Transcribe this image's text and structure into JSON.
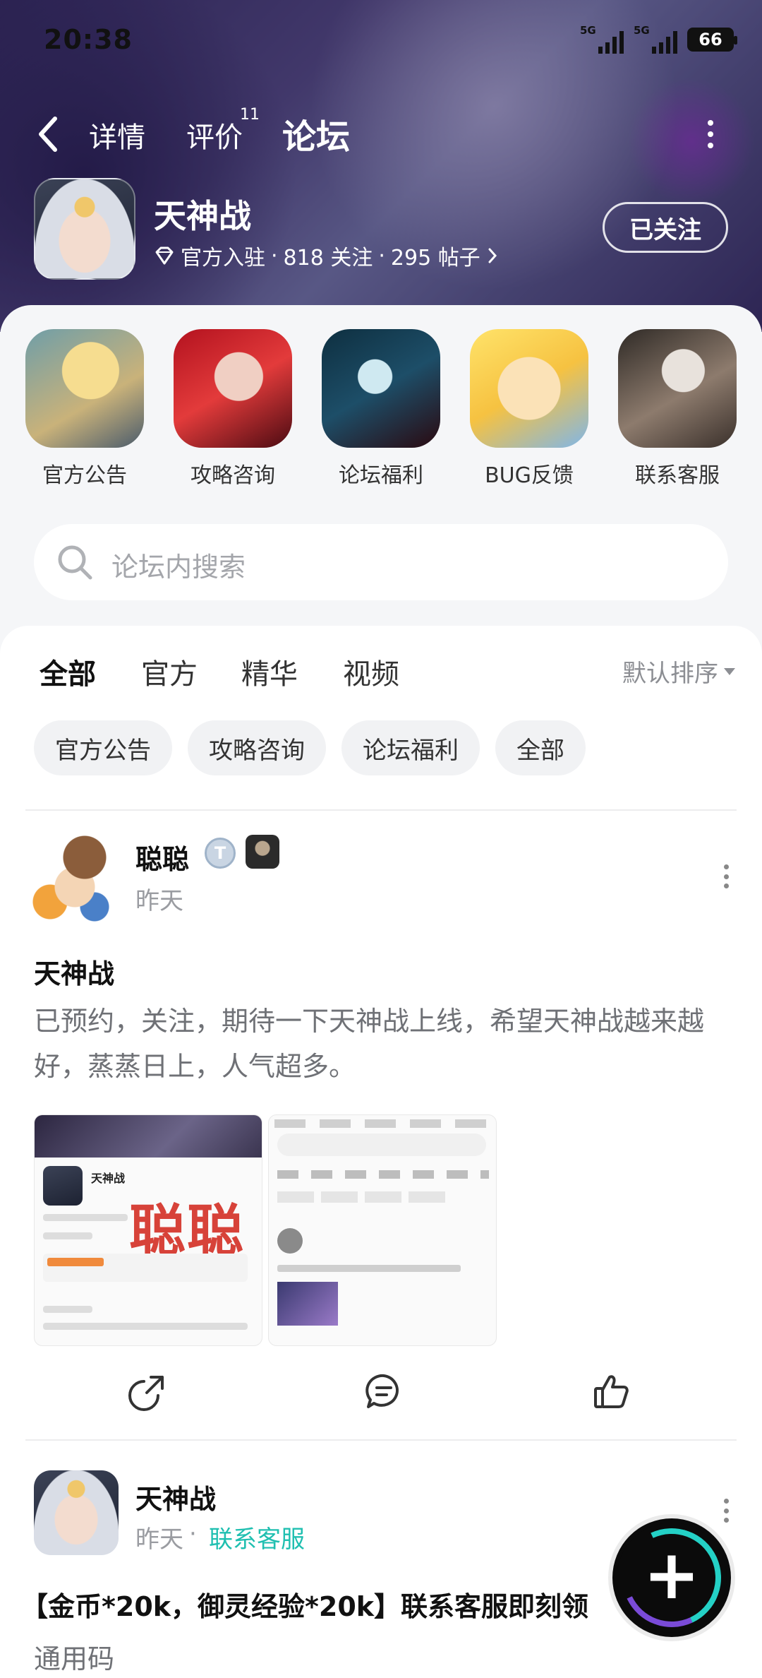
{
  "status_bar": {
    "time": "20:38",
    "network_1": "5G",
    "network_2": "5G",
    "battery": "66"
  },
  "nav": {
    "tabs": [
      {
        "label": "详情"
      },
      {
        "label": "评价"
      },
      {
        "label": "论坛"
      }
    ],
    "review_count": "11",
    "active_tab": "论坛"
  },
  "game": {
    "title": "天神战",
    "official_text": "官方入驻",
    "followers": "818 关注",
    "posts": "295 帖子",
    "separator": "·",
    "follow_button": "已关注"
  },
  "shortcuts": [
    {
      "label": "官方公告"
    },
    {
      "label": "攻略咨询"
    },
    {
      "label": "论坛福利"
    },
    {
      "label": "BUG反馈"
    },
    {
      "label": "联系客服"
    }
  ],
  "search": {
    "placeholder": "论坛内搜索"
  },
  "filters": {
    "tabs": [
      {
        "label": "全部"
      },
      {
        "label": "官方"
      },
      {
        "label": "精华"
      },
      {
        "label": "视频"
      }
    ],
    "sort_label": "默认排序",
    "chips": [
      {
        "label": "官方公告"
      },
      {
        "label": "攻略咨询"
      },
      {
        "label": "论坛福利"
      },
      {
        "label": "全部"
      }
    ]
  },
  "posts": [
    {
      "author": "聪聪",
      "time": "昨天",
      "title": "天神战",
      "body": "已预约，关注，期待一下天神战上线，希望天神战越来越好，蒸蒸日上，人气超多。",
      "image_watermark": "聪聪"
    },
    {
      "author": "天神战",
      "time": "昨天",
      "category": "联系客服",
      "title": "【金币*20k，御灵经验*20k】联系客服即刻领",
      "subtitle": "通用码"
    }
  ],
  "colors": {
    "accent": "#2fd5c8",
    "link": "#1fbfb0",
    "watermark": "#d2281e"
  },
  "icons": {
    "back": "chevron-left-icon",
    "more": "more-vertical-icon",
    "official": "diamond-icon",
    "search": "search-icon",
    "share": "share-icon",
    "comment": "comment-icon",
    "like": "thumbs-up-icon",
    "fab": "plus-icon"
  }
}
